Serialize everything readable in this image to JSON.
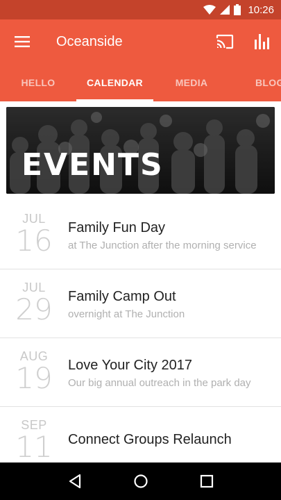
{
  "status_bar": {
    "time": "10:26"
  },
  "app_bar": {
    "title": "Oceanside"
  },
  "tabs": [
    {
      "label": "HELLO"
    },
    {
      "label": "CALENDAR"
    },
    {
      "label": "MEDIA"
    },
    {
      "label": "BLOG"
    }
  ],
  "banner": {
    "title": "EVENTS"
  },
  "events": [
    {
      "month": "JUL",
      "day": "16",
      "title": "Family Fun Day",
      "subtitle": "at The Junction after the morning service"
    },
    {
      "month": "JUL",
      "day": "29",
      "title": "Family Camp Out",
      "subtitle": "overnight at The Junction"
    },
    {
      "month": "AUG",
      "day": "19",
      "title": "Love Your City 2017",
      "subtitle": "Our big annual outreach in the park day"
    },
    {
      "month": "SEP",
      "day": "11",
      "title": "Connect Groups Relaunch",
      "subtitle": ""
    }
  ],
  "colors": {
    "primary": "#ee5a3f",
    "status": "#c4432b"
  },
  "icons": [
    "wifi-icon",
    "signal-icon",
    "battery-icon",
    "menu-icon",
    "cast-icon",
    "chart-icon",
    "back-icon",
    "home-icon",
    "recents-icon"
  ]
}
